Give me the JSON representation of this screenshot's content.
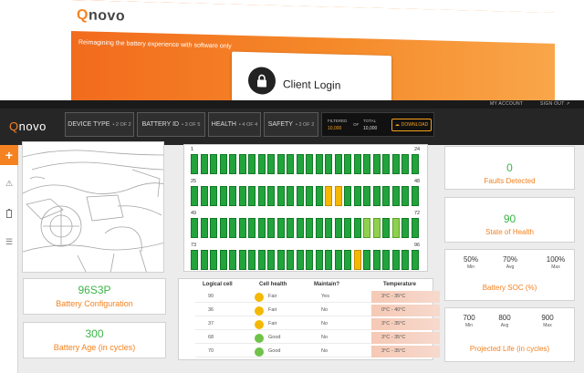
{
  "promo": {
    "logo": "novo",
    "tagline": "Reimagining the battery experience with software only",
    "login_label": "Client Login"
  },
  "topbar": {
    "account": "MY ACCOUNT",
    "signout": "SIGN OUT"
  },
  "logo": "novo",
  "filters": [
    {
      "label": "DEVICE TYPE",
      "sub": "2 OF 2"
    },
    {
      "label": "BATTERY ID",
      "sub": "3 OF 5"
    },
    {
      "label": "HEALTH",
      "sub": "4 OF 4"
    },
    {
      "label": "SAFETY",
      "sub": "2 OF 2"
    }
  ],
  "counter": {
    "filtered_label": "FILTERED",
    "filtered_value": "10,000",
    "of": "OF",
    "total_label": "TOTAL",
    "total_value": "10,000",
    "download": "DOWNLOAD"
  },
  "grid": {
    "row_labels": [
      {
        "left": "1",
        "right": "24"
      },
      {
        "left": "25",
        "right": "48"
      },
      {
        "left": "49",
        "right": "72"
      },
      {
        "left": "73",
        "right": "96"
      }
    ],
    "cell_status": [
      "gggggggggggggggggggggggg",
      "ggggggggggggggyyggggggggg",
      "ggggggggggggggggggllglgggg",
      "gggggggggggggggggyggggggg"
    ]
  },
  "config": {
    "value": "96S3P",
    "caption": "Battery Configuration"
  },
  "age": {
    "value": "300",
    "caption": "Battery Age (in cycles)"
  },
  "faults": {
    "value": "0",
    "caption": "Faults Detected"
  },
  "health": {
    "value": "90",
    "caption": "State of Health"
  },
  "soc": {
    "items": [
      {
        "value": "50%",
        "sub": "Min"
      },
      {
        "value": "70%",
        "sub": "Avg"
      },
      {
        "value": "100%",
        "sub": "Max"
      }
    ],
    "caption": "Battery SOC (%)"
  },
  "life": {
    "items": [
      {
        "value": "700",
        "sub": "Min"
      },
      {
        "value": "800",
        "sub": "Avg"
      },
      {
        "value": "900",
        "sub": "Max"
      }
    ],
    "caption": "Projected Life (in cycles)"
  },
  "table": {
    "headers": [
      "Logical cell",
      "Cell health",
      "Maintain?",
      "Temperature"
    ],
    "rows": [
      {
        "cell": "90",
        "health": "Fair",
        "color": "#f5b800",
        "maintain": "Yes",
        "temp": "3°C - 35°C"
      },
      {
        "cell": "36",
        "health": "Fair",
        "color": "#f5b800",
        "maintain": "No",
        "temp": "0°C - 40°C"
      },
      {
        "cell": "37",
        "health": "Fair",
        "color": "#f5b800",
        "maintain": "No",
        "temp": "3°C - 35°C"
      },
      {
        "cell": "68",
        "health": "Good",
        "color": "#6fc24a",
        "maintain": "No",
        "temp": "3°C - 35°C"
      },
      {
        "cell": "70",
        "health": "Good",
        "color": "#6fc24a",
        "maintain": "No",
        "temp": "3°C - 35°C"
      }
    ]
  }
}
